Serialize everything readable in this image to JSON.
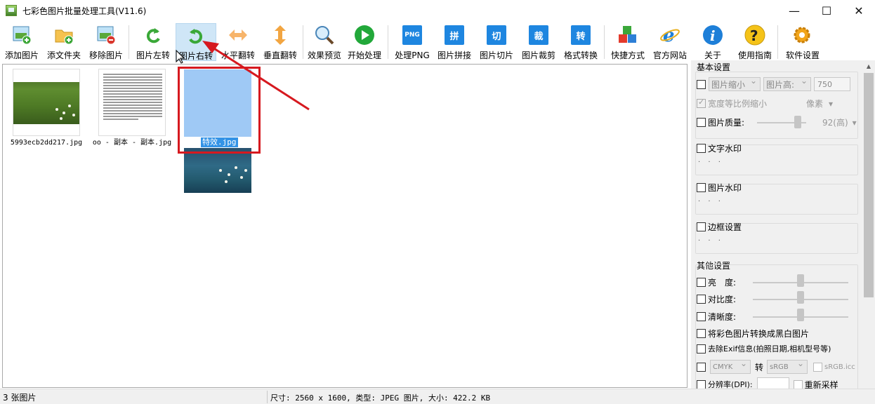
{
  "window": {
    "title": "七彩色图片批量处理工具(V11.6)",
    "minimize": "—",
    "maximize": "☐",
    "close": "✕"
  },
  "toolbar": {
    "add_image": "添加图片",
    "add_folder": "添文件夹",
    "remove_image": "移除图片",
    "rotate_left": "图片左转",
    "rotate_right": "图片右转",
    "flip_h": "水平翻转",
    "flip_v": "垂直翻转",
    "preview": "效果预览",
    "start": "开始处理",
    "png": "处理PNG",
    "png_icon": "PNG",
    "stitch": "图片拼接",
    "stitch_icon": "拼",
    "slice": "图片切片",
    "slice_icon": "切",
    "crop": "图片裁剪",
    "crop_icon": "裁",
    "convert": "格式转换",
    "convert_icon": "转",
    "shortcut": "快捷方式",
    "website": "官方网站",
    "about": "关于",
    "guide": "使用指南",
    "settings": "软件设置"
  },
  "files": [
    {
      "name": "5993ecb2dd217.jpg"
    },
    {
      "name": "oo - 副本 - 副本.jpg"
    },
    {
      "name": "特效.jpg"
    }
  ],
  "panel": {
    "basic_title": "基本设置",
    "resize_option": "图片缩小",
    "height_option": "图片高:",
    "height_value": "750",
    "keep_ratio": "宽度等比例缩小",
    "unit": "像素",
    "quality": "图片质量:",
    "quality_value": "92(高)",
    "text_watermark": "文字水印",
    "image_watermark": "图片水印",
    "border": "边框设置",
    "dots": "· · ·",
    "other_title": "其他设置",
    "brightness": "亮　度:",
    "contrast": "对比度:",
    "sharpness": "清晰度:",
    "grayscale": "将彩色图片转换成黑白图片",
    "remove_exif": "去除Exif信息(拍照日期,相机型号等)",
    "cmyk": "CMYK",
    "convert_to": "转",
    "srgb": "sRGB",
    "srgb_icc": "sRGB.icc",
    "dpi": "分辨率(DPI):",
    "resample": "重新采样"
  },
  "status": {
    "count": "3 张图片",
    "info": "尺寸: 2560 x 1600, 类型: JPEG 图片, 大小: 422.2 KB"
  },
  "colors": {
    "accent_blue": "#1e86e0",
    "annotation_red": "#d6191f"
  }
}
